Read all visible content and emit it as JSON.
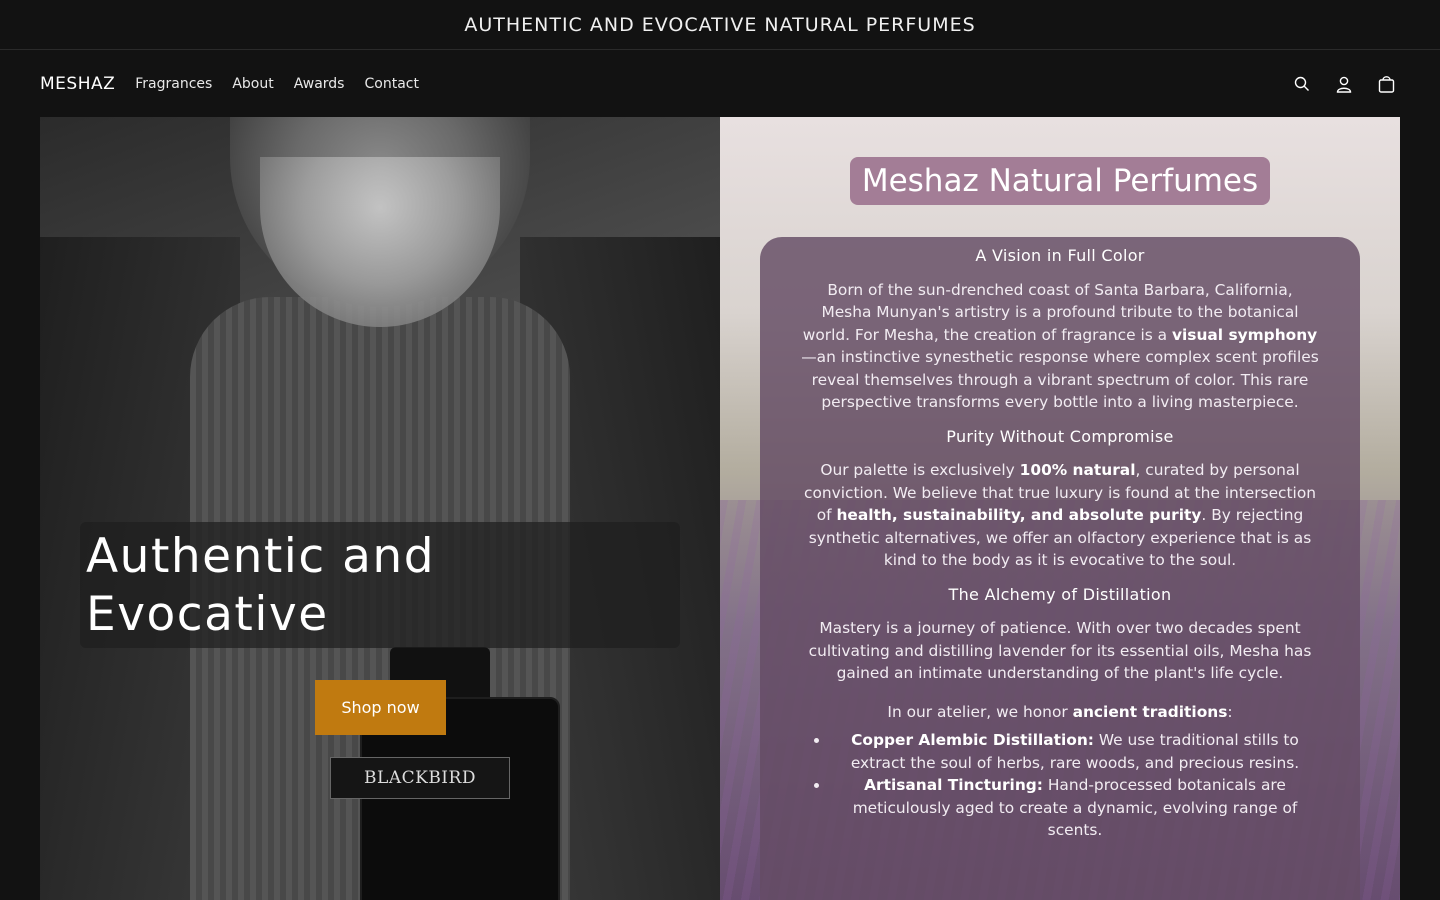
{
  "announcement": "AUTHENTIC AND EVOCATIVE NATURAL PERFUMES",
  "header": {
    "logo": "MESHAZ",
    "nav": [
      "Fragrances",
      "About",
      "Awards",
      "Contact"
    ],
    "icons": [
      "search-icon",
      "account-icon",
      "cart-icon"
    ]
  },
  "hero": {
    "title_line1": "Authentic and",
    "title_line2": "Evocative",
    "button": "Shop now",
    "bottle_label": "BLACKBIRD"
  },
  "panel": {
    "title": "Meshaz Natural Perfumes",
    "s1_heading": "A Vision in Full Color",
    "s1_text_a": "Born of the sun-drenched coast of Santa Barbara, California, Mesha Munyan's artistry is a profound tribute to the botanical world. For Mesha, the creation of fragrance is a ",
    "s1_bold": "visual symphony",
    "s1_text_b": "—an instinctive synesthetic response where complex scent profiles reveal themselves through a vibrant spectrum of color. This rare perspective transforms every bottle into a living masterpiece.",
    "s2_heading": "Purity Without Compromise",
    "s2_text_a": "Our palette is exclusively ",
    "s2_bold1": "100% natural",
    "s2_text_b": ", curated by personal conviction. We believe that true luxury is found at the intersection of ",
    "s2_bold2": "health, sustainability, and absolute purity",
    "s2_text_c": ". By rejecting synthetic alternatives, we offer an olfactory experience that is as kind to the body as it is evocative to the soul.",
    "s3_heading": "The Alchemy of Distillation",
    "s3_text": "Mastery is a journey of patience. With over two decades spent cultivating and distilling lavender for its essential oils, Mesha has gained an intimate understanding of the plant's life cycle.",
    "s4_text_a": "In our atelier, we honor ",
    "s4_bold": "ancient traditions",
    "s4_text_b": ":",
    "list": [
      {
        "bold": "Copper Alembic Distillation:",
        "text": " We use traditional stills to extract the soul of herbs, rare woods, and precious resins."
      },
      {
        "bold": "Artisanal Tincturing:",
        "text": " Hand-processed botanicals are meticulously aged to create a dynamic, evolving range of scents."
      }
    ]
  },
  "colors": {
    "background": "#121212",
    "button": "#c07a10",
    "pill": "#a37d96",
    "card": "#644c64"
  }
}
